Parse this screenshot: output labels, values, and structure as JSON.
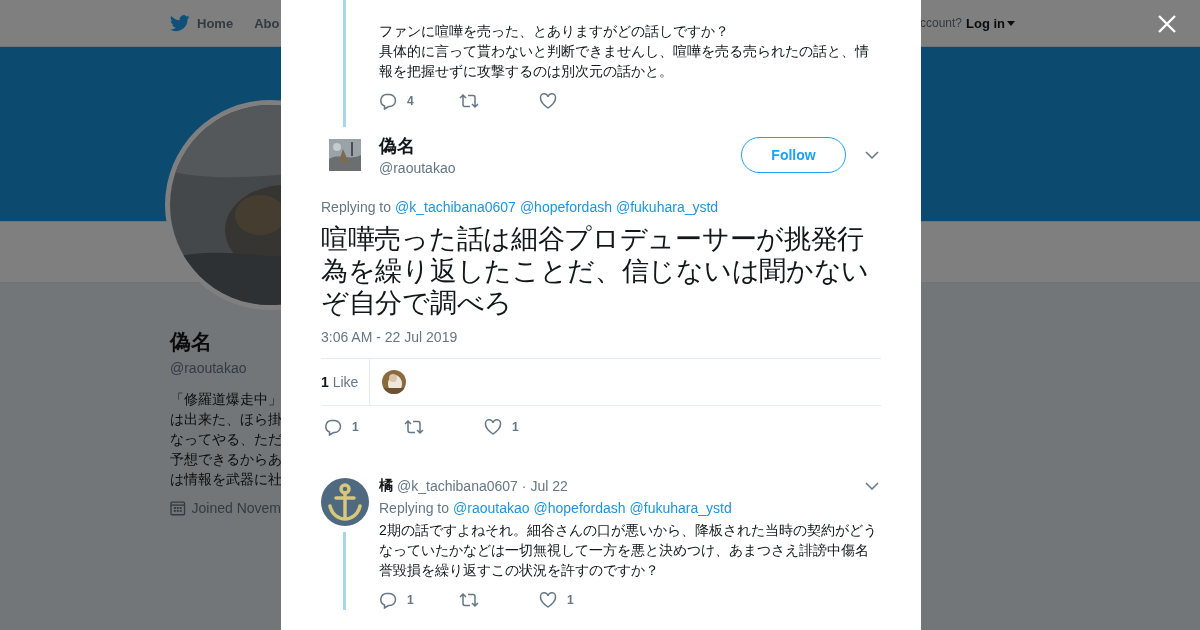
{
  "nav": {
    "items": [
      {
        "label": "Home",
        "kind": "home"
      },
      {
        "label": "Abo",
        "kind": "plain"
      }
    ],
    "account_prompt": "ccount?",
    "login": "Log in"
  },
  "profile": {
    "name": "偽名",
    "handle": "@raoutakao",
    "bio_lines": [
      "「修羅道爆走中」",
      "は出来た、ほら掛",
      "なってやる、ただ",
      "予想できるからあ",
      "は情報を武器に社"
    ],
    "joined": "Joined Novem"
  },
  "parent_tweet": {
    "paragraphs": [
      "ファンに喧嘩を売った、とありますがどの話しですか？",
      "具体的に言って貰わないと判断できませんし、喧嘩を売る売られたの話と、情報を把握せずに攻撃するのは別次元の話かと。"
    ],
    "actions": [
      {
        "kind": "reply",
        "count": "4"
      },
      {
        "kind": "retweet"
      },
      {
        "kind": "like"
      }
    ]
  },
  "main_tweet": {
    "name": "偽名",
    "handle": "@raoutakao",
    "follow": "Follow",
    "replying_label": "Replying to",
    "mentions": [
      "@k_tachibana0607",
      "@hopefordash",
      "@fukuhara_ystd"
    ],
    "text": "喧嘩売った話は細谷プロデューサーが挑発行為を繰り返したことだ、信じないは聞かないぞ自分で調べろ",
    "timestamp": "3:06 AM - 22 Jul 2019",
    "like_count": "1",
    "like_label": "Like",
    "actions": [
      {
        "kind": "reply",
        "count": "1"
      },
      {
        "kind": "retweet"
      },
      {
        "kind": "like",
        "count": "1"
      }
    ]
  },
  "reply": {
    "name": "橘",
    "handle": "@k_tachibana0607",
    "date": "· Jul 22",
    "replying_label": "Replying to",
    "mentions": [
      "@raoutakao",
      "@hopefordash",
      "@fukuhara_ystd"
    ],
    "text": "2期の話ですよねそれ。細谷さんの口が悪いから、降板された当時の契約がどうなっていたかなどは一切無視して一方を悪と決めつけ、あまつさえ誹謗中傷名誉毀損を繰り返すこの状況を許すのですか？",
    "actions": [
      {
        "kind": "reply",
        "count": "1"
      },
      {
        "kind": "retweet"
      },
      {
        "kind": "like",
        "count": "1"
      }
    ]
  }
}
